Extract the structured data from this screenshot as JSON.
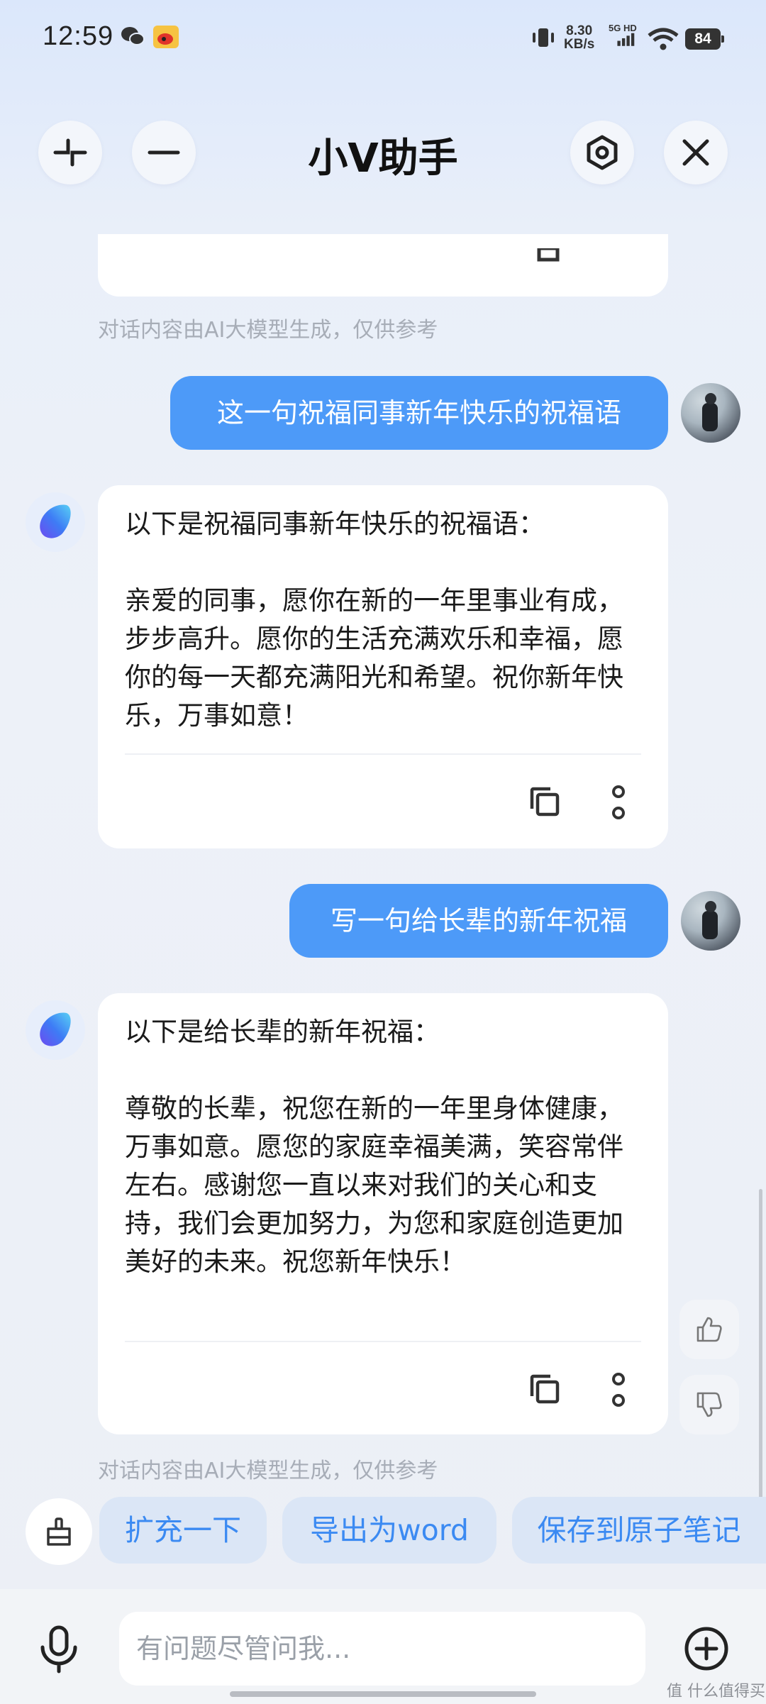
{
  "status_bar": {
    "time": "12:59",
    "net_speed_value": "8.30",
    "net_speed_unit": "KB/s",
    "network_label": "5G HD",
    "battery": "84"
  },
  "header": {
    "title": "小V助手"
  },
  "messages": {
    "disclaimer_top": "对话内容由AI大模型生成，仅供参考",
    "user_1": "这一句祝福同事新年快乐的祝福语",
    "ai_1": "以下是祝福同事新年快乐的祝福语：\n\n亲爱的同事，愿你在新的一年里事业有成，步步高升。愿你的生活充满欢乐和幸福，愿你的每一天都充满阳光和希望。祝你新年快乐，万事如意！",
    "user_2": "写一句给长辈的新年祝福",
    "ai_2": "以下是给长辈的新年祝福：\n\n尊敬的长辈，祝您在新的一年里身体健康，万事如意。愿您的家庭幸福美满，笑容常伴左右。感谢您一直以来对我们的关心和支持，我们会更加努力，为您和家庭创造更加美好的未来。祝您新年快乐！",
    "disclaimer_bottom": "对话内容由AI大模型生成，仅供参考"
  },
  "suggestions": [
    "扩充一下",
    "导出为word",
    "保存到原子笔记"
  ],
  "input": {
    "placeholder": "有问题尽管问我..."
  },
  "watermark": "值 什么值得买",
  "colors": {
    "accent": "#4d9af8",
    "chip_text": "#3b8af2",
    "chip_bg": "#dbe6f6"
  }
}
